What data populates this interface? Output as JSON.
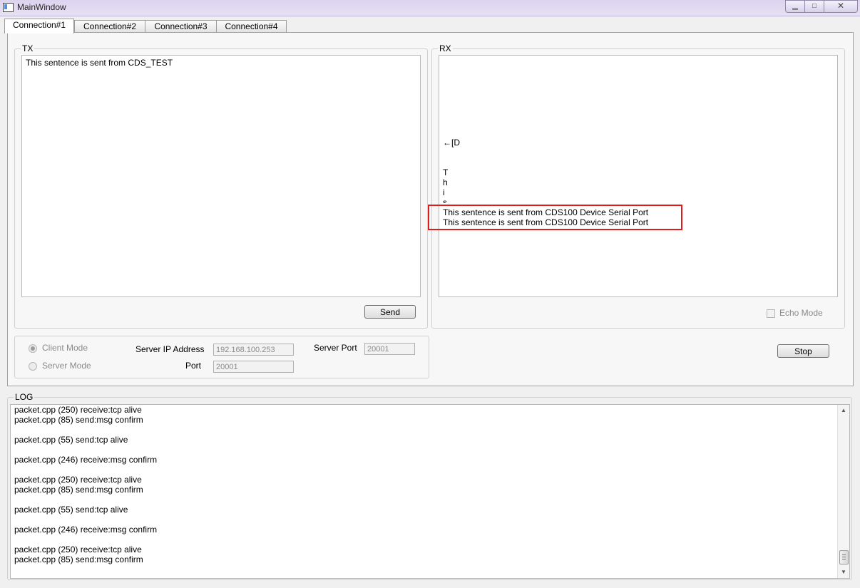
{
  "window": {
    "title": "MainWindow",
    "min_glyph": "▁",
    "max_glyph": "□",
    "close_glyph": "✕"
  },
  "tabs": [
    "Connection#1",
    "Connection#2",
    "Connection#3",
    "Connection#4"
  ],
  "tx": {
    "group_title": "TX",
    "text": "This sentence is sent from CDS_TEST",
    "send_label": "Send"
  },
  "rx": {
    "group_title": "RX",
    "lines": [
      "←[D",
      "T",
      "h",
      "i",
      "s",
      "This sentence is sent from CDS100 Device Serial Port",
      "This sentence is sent from CDS100 Device Serial Port"
    ],
    "echo_label": "Echo Mode"
  },
  "connection": {
    "client_mode_label": "Client Mode",
    "server_mode_label": "Server Mode",
    "server_ip_label": "Server IP Address",
    "server_ip_value": "192.168.100.253",
    "server_port_label": "Server Port",
    "server_port_value": "20001",
    "port_label": "Port",
    "port_value": "20001",
    "stop_label": "Stop"
  },
  "log": {
    "group_title": "LOG",
    "lines": [
      "packet.cpp (250) receive:tcp alive",
      "packet.cpp (85) send:msg confirm",
      "",
      "packet.cpp (55) send:tcp alive",
      "",
      "packet.cpp (246) receive:msg confirm",
      "",
      "packet.cpp (250) receive:tcp alive",
      "packet.cpp (85) send:msg confirm",
      "",
      "packet.cpp (55) send:tcp alive",
      "",
      "packet.cpp (246) receive:msg confirm",
      "",
      "packet.cpp (250) receive:tcp alive",
      "packet.cpp (85) send:msg confirm"
    ],
    "scroll_up_glyph": "▲",
    "scroll_down_glyph": "▼"
  }
}
